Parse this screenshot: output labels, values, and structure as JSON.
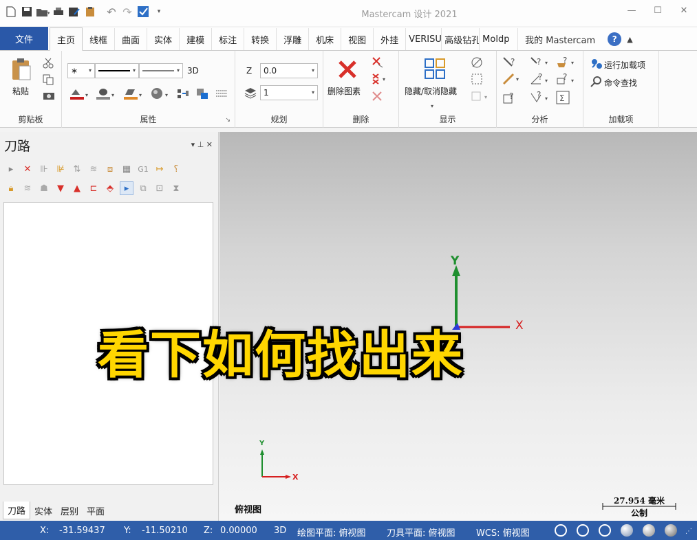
{
  "app": {
    "title": "Mastercam 设计 2021"
  },
  "quick_access": [
    "new-file-icon",
    "save-icon",
    "open-folder-icon",
    "print-icon",
    "save-as-icon",
    "clipboard-icon",
    "undo-icon",
    "redo-icon",
    "verify-icon",
    "customize-icon"
  ],
  "window_controls": {
    "minimize": "—",
    "maximize": "☐",
    "close": "✕"
  },
  "ribbon_tabs": {
    "file": "文件",
    "tabs": [
      "主页",
      "线框",
      "曲面",
      "实体",
      "建模",
      "标注",
      "转换",
      "浮雕",
      "机床",
      "视图",
      "外挂",
      "VERISU",
      "高级钻孔",
      "Moldp"
    ],
    "active": "主页",
    "right": "我的 Mastercam",
    "help": "?",
    "collapse": "▲"
  },
  "ribbon": {
    "clipboard": {
      "paste": "粘贴",
      "label": "剪贴板"
    },
    "attributes": {
      "label": "属性",
      "mode": "3D",
      "launcher": "↘"
    },
    "planning": {
      "label": "规划",
      "z_label": "Z",
      "z_value": "0.0",
      "level_value": "1"
    },
    "delete": {
      "label": "删除",
      "delete_entity": "删除图素"
    },
    "display": {
      "label": "显示",
      "hide_unhide": "隐藏/取消隐藏"
    },
    "analysis": {
      "label": "分析"
    },
    "addins": {
      "label": "加载项",
      "run_addin": "运行加载项",
      "command_finder": "命令查找"
    }
  },
  "toolpath_panel": {
    "title": "刀路",
    "pin": "▾  ⊥  ✕",
    "tabs": [
      "刀路",
      "实体",
      "层别",
      "平面"
    ],
    "active_tab": "刀路"
  },
  "viewport": {
    "view_name": "俯视图",
    "scale_value": "27.954 毫米",
    "scale_unit": "公制",
    "axis_y": "Y",
    "axis_x": "X",
    "caption": "看下如何找出来"
  },
  "statusbar": {
    "x_label": "X:",
    "x_value": "-31.59437",
    "y_label": "Y:",
    "y_value": "-11.50210",
    "z_label": "Z:",
    "z_value": "0.00000",
    "mode": "3D",
    "cplane": "绘图平面: 俯视图",
    "tplane": "刀具平面: 俯视图",
    "wcs": "WCS: 俯视图"
  },
  "colors": {
    "accent": "#2a58a8",
    "status": "#2f5ea9",
    "caption": "#ffd600",
    "axis_y": "#1f8f2f",
    "axis_x": "#d62020"
  }
}
